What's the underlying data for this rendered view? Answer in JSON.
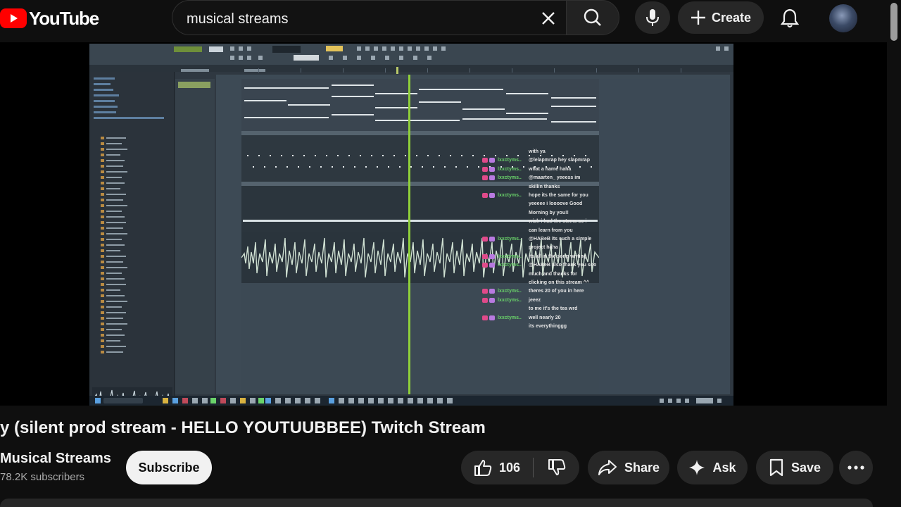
{
  "header": {
    "logo_text": "YouTube",
    "search_value": "musical streams",
    "create_label": "Create"
  },
  "video": {
    "title": "y (silent prod stream - HELLO YOUTUUBBEE) Twitch Stream",
    "chat": [
      {
        "user": "",
        "msg": "with ya"
      },
      {
        "user": "lxxctyms..",
        "msg": "@lelapmrap hey slapmrap"
      },
      {
        "user": "lxxctyms..",
        "msg": "what a name haha"
      },
      {
        "user": "lxxctyms..",
        "msg": "@maarten_ yeeess im"
      },
      {
        "user": "",
        "msg": "skillin thanks"
      },
      {
        "user": "lxxctyms..",
        "msg": "hope its the same for you"
      },
      {
        "user": "",
        "msg": "yeeeee i loooove Good"
      },
      {
        "user": "",
        "msg": "Morning by you!!"
      },
      {
        "user": "",
        "msg": "wish i had the stems so i"
      },
      {
        "user": "",
        "msg": "can learn from you"
      },
      {
        "user": "lxxctyms..",
        "msg": "@HABeB its such a simple"
      },
      {
        "user": "",
        "msg": "project haha"
      },
      {
        "user": "lxxctyms..",
        "msg": "its all in the song writing"
      },
      {
        "user": "lxxctyms..",
        "msg": "@HABeB also thank you soo"
      },
      {
        "user": "",
        "msg": "much and thanks for"
      },
      {
        "user": "",
        "msg": "clicking on this stream ^^"
      },
      {
        "user": "lxxctyms..",
        "msg": "theres 20 of you in here"
      },
      {
        "user": "lxxctyms..",
        "msg": "jeeez"
      },
      {
        "user": "",
        "msg": "to me it's the tea wrd"
      },
      {
        "user": "lxxctyms..",
        "msg": "well nearly 20"
      },
      {
        "user": "",
        "msg": "its everythinggg"
      }
    ]
  },
  "channel": {
    "name": "Musical Streams",
    "subscribers": "78.2K subscribers",
    "subscribe_label": "Subscribe"
  },
  "actions": {
    "like_count": "106",
    "share_label": "Share",
    "ask_label": "Ask",
    "save_label": "Save"
  },
  "colors": {
    "brand_red": "#ff0000",
    "playhead": "#8fcf3a",
    "chat_user": "#6ad36a"
  }
}
